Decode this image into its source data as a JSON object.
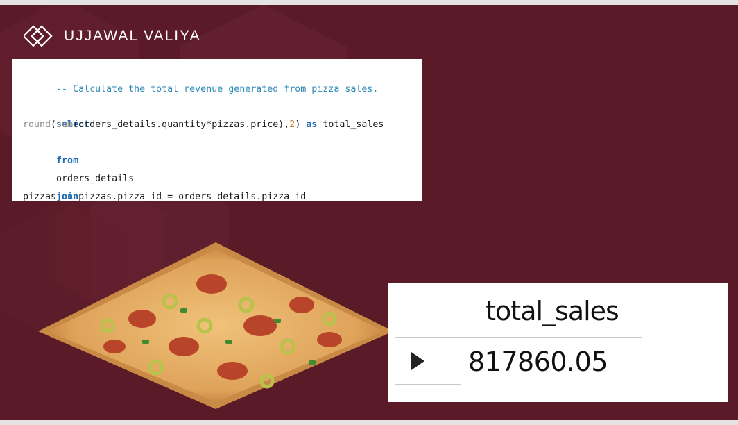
{
  "brand": {
    "name": "UJJAWAL VALIYA",
    "logo_icon": "interlocking-diamonds-logo"
  },
  "query": {
    "comment": "-- Calculate the total revenue generated from pizza sales.",
    "line_select": "select",
    "line_round_fn": "round",
    "line_round_paren": "(",
    "line_sum_fn": "sum",
    "line_sum_args": "(orders_details.quantity*pizzas.price),",
    "line_digits": "2",
    "line_close": ") ",
    "line_as": "as",
    "line_alias": " total_sales",
    "line_from": "from",
    "line_table": "orders_details",
    "line_join": "join",
    "line_join_table": "pizzas ",
    "line_on": "on",
    "line_condition": " pizzas.pizza_id = orders_details.pizza_id"
  },
  "result": {
    "column_header": "total_sales",
    "value": "817860.05",
    "row_marker_icon": "row-pointer-icon"
  },
  "colors": {
    "background": "#5a1a28",
    "keyword": "#1f6bb5",
    "comment": "#2e8bb8"
  }
}
